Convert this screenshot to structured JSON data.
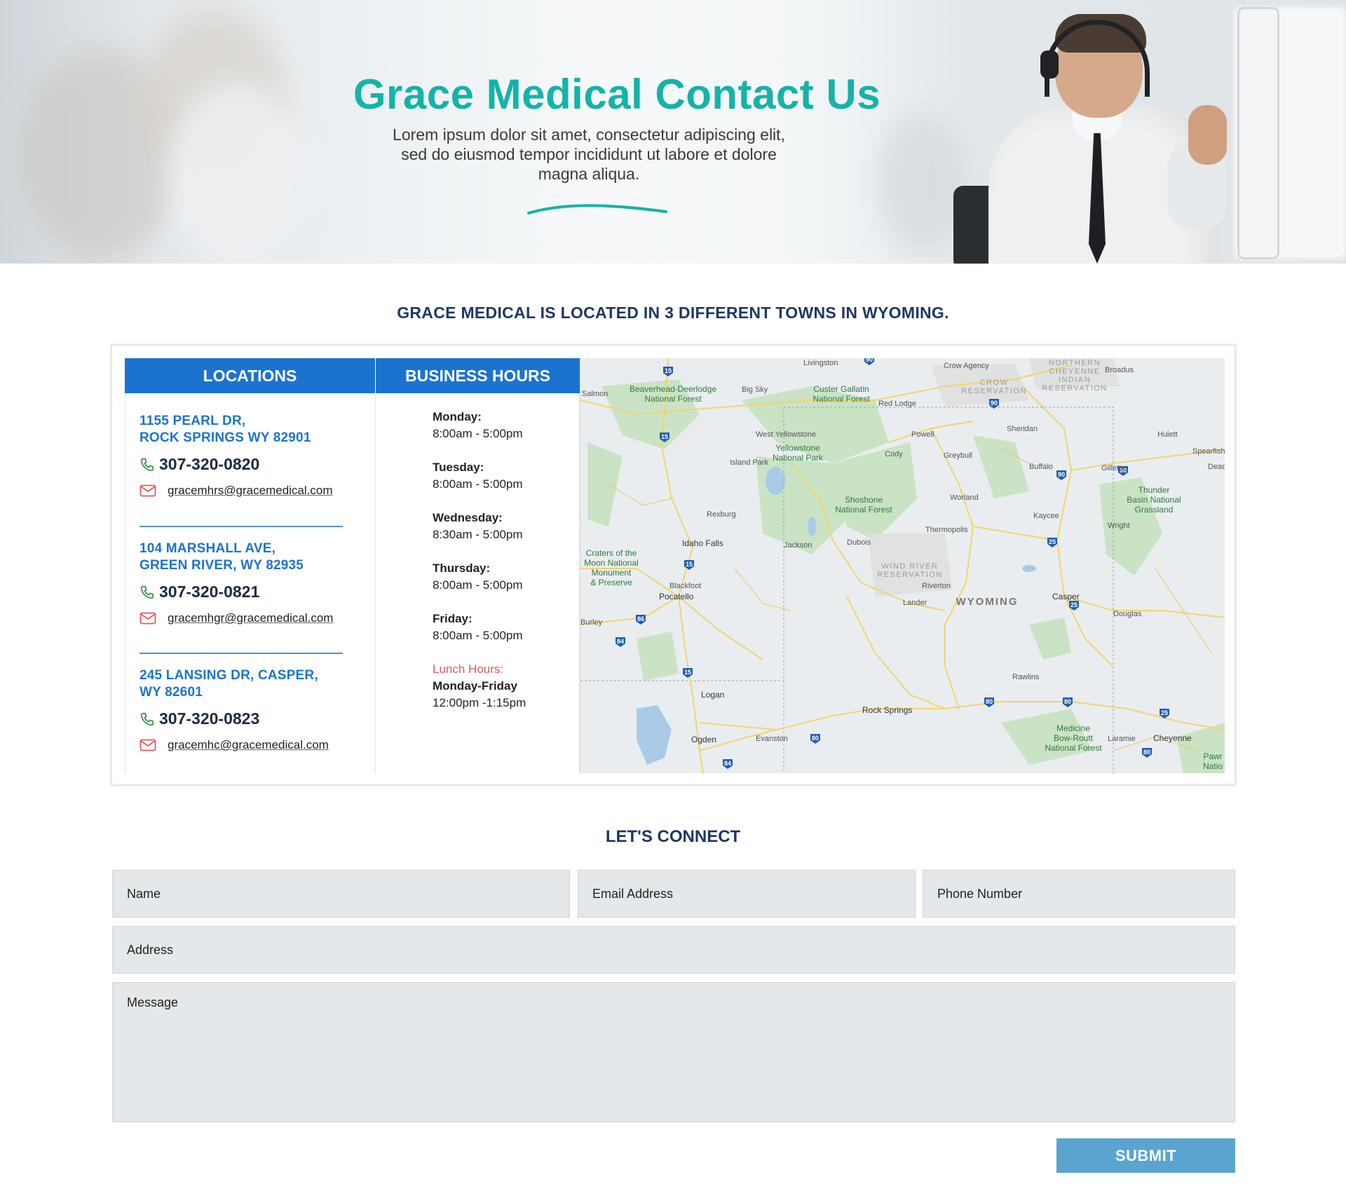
{
  "hero": {
    "title": "Grace Medical Contact Us",
    "subtitle": "Lorem ipsum dolor sit amet, consectetur adipiscing elit, sed do eiusmod tempor incididunt ut labore et dolore magna aliqua."
  },
  "locations_heading": "GRACE MEDICAL IS LOCATED IN 3 DIFFERENT TOWNS IN WYOMING.",
  "panel": {
    "locations_header": "LOCATIONS",
    "hours_header": "BUSINESS HOURS",
    "locations": [
      {
        "addr_line1": "1155 PEARL DR,",
        "addr_line2": "ROCK SPRINGS WY 82901",
        "phone": "307-320-0820",
        "email": "gracemhrs@gracemedical.com"
      },
      {
        "addr_line1": "104 MARSHALL AVE,",
        "addr_line2": "GREEN RIVER, WY 82935",
        "phone": "307-320-0821",
        "email": "gracemhgr@gracemedical.com"
      },
      {
        "addr_line1": "245 LANSING DR, CASPER,",
        "addr_line2": "WY 82601",
        "phone": "307-320-0823",
        "email": "gracemhc@gracemedical.com"
      }
    ],
    "hours": [
      {
        "day": "Monday:",
        "time": "8:00am - 5:00pm"
      },
      {
        "day": "Tuesday:",
        "time": "8:00am - 5:00pm"
      },
      {
        "day": "Wednesday:",
        "time": "8:30am - 5:00pm"
      },
      {
        "day": "Thursday:",
        "time": "8:00am - 5:00pm"
      },
      {
        "day": "Friday:",
        "time": "8:00am - 5:00pm"
      }
    ],
    "lunch_label": "Lunch Hours:",
    "lunch_days": "Monday-Friday",
    "lunch_time": "12:00pm -1:15pm"
  },
  "map": {
    "labels": {
      "wyoming": "WYOMING",
      "livingston": "Livingston",
      "crow_agency": "Crow Agency",
      "cheyenne_res": "NORTHERN CHEYENNE INDIAN RESERVATION",
      "broadus": "Broadus",
      "crow_res": "CROW RESERVATION",
      "salmon": "Salmon",
      "beaverhead": "Beaverhead-Deerlodge National Forest",
      "big_sky": "Big Sky",
      "custer": "Custer Gallatin National Forest",
      "red_lodge": "Red Lodge",
      "sheridan": "Sheridan",
      "hulett": "Hulett",
      "spearfish": "Spearfish",
      "west_yellowstone": "West Yellowstone",
      "powell": "Powell",
      "cody": "Cody",
      "island_park": "Island Park",
      "yellowstone": "Yellowstone National Park",
      "greybull": "Greybull",
      "buffalo": "Buffalo",
      "gillette": "Gillette",
      "deadwood": "Deadw",
      "shoshone": "Shoshone National Forest",
      "worland": "Worland",
      "thunder_basin": "Thunder Basin National Grassland",
      "rexburg": "Rexburg",
      "kaycee": "Kaycee",
      "wright": "Wright",
      "thermopolis": "Thermopolis",
      "idaho_falls": "Idaho Falls",
      "jackson": "Jackson",
      "dubois": "Dubois",
      "craters": "Craters of the Moon National Monument & Preserve",
      "wind_river": "WIND RIVER RESERVATION",
      "blackfoot": "Blackfoot",
      "riverton": "Riverton",
      "pocatello": "Pocatello",
      "lander": "Lander",
      "casper": "Casper",
      "douglas": "Douglas",
      "burley": "Burley",
      "rawlins": "Rawlins",
      "logan": "Logan",
      "rock_springs": "Rock Springs",
      "medicine_bow": "Medicine Bow-Routt National Forest",
      "ogden": "Ogden",
      "evanston": "Evanston",
      "laramie": "Laramie",
      "cheyenne": "Cheyenne",
      "pawnee": "Pawr Natio"
    },
    "interstates": [
      "15",
      "90",
      "25",
      "80",
      "84",
      "86"
    ]
  },
  "connect_heading": "LET'S CONNECT",
  "form": {
    "name": "Name",
    "email": "Email Address",
    "phone": "Phone Number",
    "address": "Address",
    "message": "Message",
    "submit": "SUBMIT"
  },
  "colors": {
    "teal_title": "#14b3a8",
    "navy_heading": "#1f3864",
    "blue_header": "#1c73cf",
    "lunch_red": "#e05a5a",
    "submit_blue": "#5aa4d0",
    "field_bg": "#e4e8ea"
  }
}
